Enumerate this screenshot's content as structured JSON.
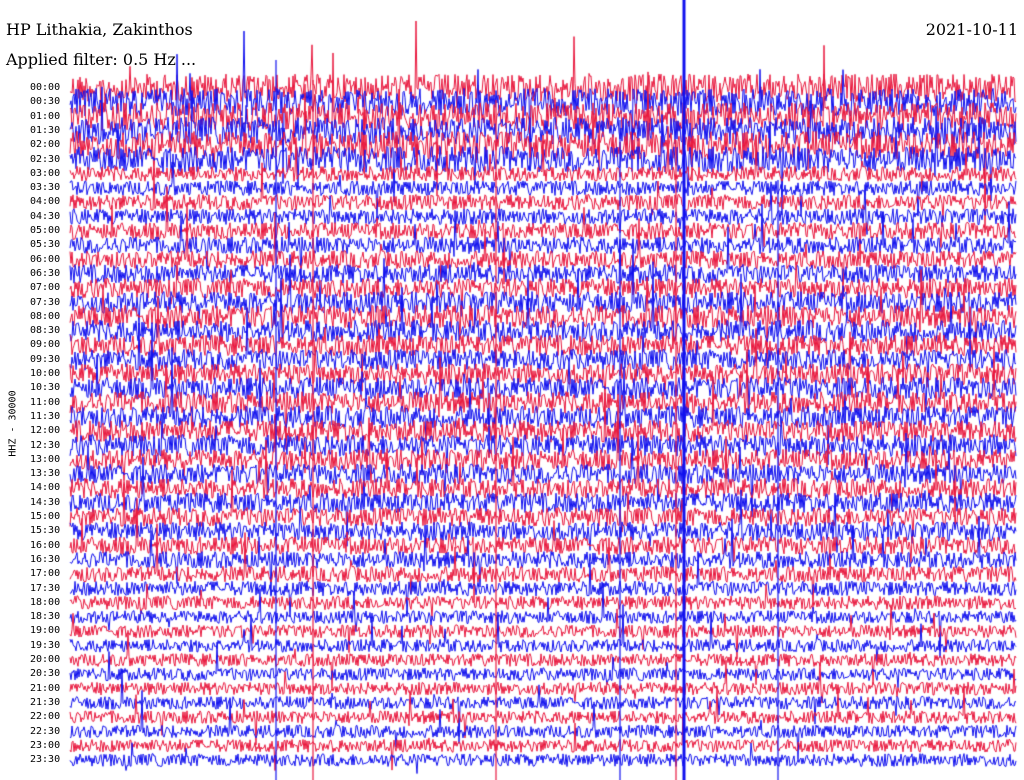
{
  "header": {
    "station": "HP Lithakia, Zakinthos",
    "date": "2021-10-11",
    "filter": "Applied filter: 0.5 Hz ..."
  },
  "chart_data": {
    "type": "line",
    "title": "HP Lithakia, Zakinthos",
    "date": "2021-10-11",
    "channel_label": "HHZ - 30000",
    "row_labels": [
      "00:00",
      "00:30",
      "01:00",
      "01:30",
      "02:00",
      "02:30",
      "03:00",
      "03:30",
      "04:00",
      "04:30",
      "05:00",
      "05:30",
      "06:00",
      "06:30",
      "07:00",
      "07:30",
      "08:00",
      "08:30",
      "09:00",
      "09:30",
      "10:00",
      "10:30",
      "11:00",
      "11:30",
      "12:00",
      "12:30",
      "13:00",
      "13:30",
      "14:00",
      "14:30",
      "15:00",
      "15:30",
      "16:00",
      "16:30",
      "17:00",
      "17:30",
      "18:00",
      "18:30",
      "19:00",
      "19:30",
      "20:00",
      "20:30",
      "21:00",
      "21:30",
      "22:00",
      "22:30",
      "23:00",
      "23:30"
    ],
    "colors": [
      "#e8173d",
      "#1010ee"
    ],
    "row_noise_level": [
      1.0,
      1.0,
      1.0,
      1.0,
      1.0,
      0.9,
      0.35,
      0.35,
      0.4,
      0.4,
      0.45,
      0.45,
      0.5,
      0.55,
      0.6,
      0.7,
      0.75,
      0.7,
      0.65,
      0.65,
      0.65,
      0.7,
      0.7,
      0.7,
      0.7,
      0.7,
      0.65,
      0.6,
      0.6,
      0.6,
      0.55,
      0.55,
      0.5,
      0.45,
      0.4,
      0.35,
      0.3,
      0.25,
      0.25,
      0.25,
      0.25,
      0.25,
      0.25,
      0.25,
      0.25,
      0.25,
      0.25,
      0.25
    ],
    "grid": false,
    "legend": "none"
  }
}
